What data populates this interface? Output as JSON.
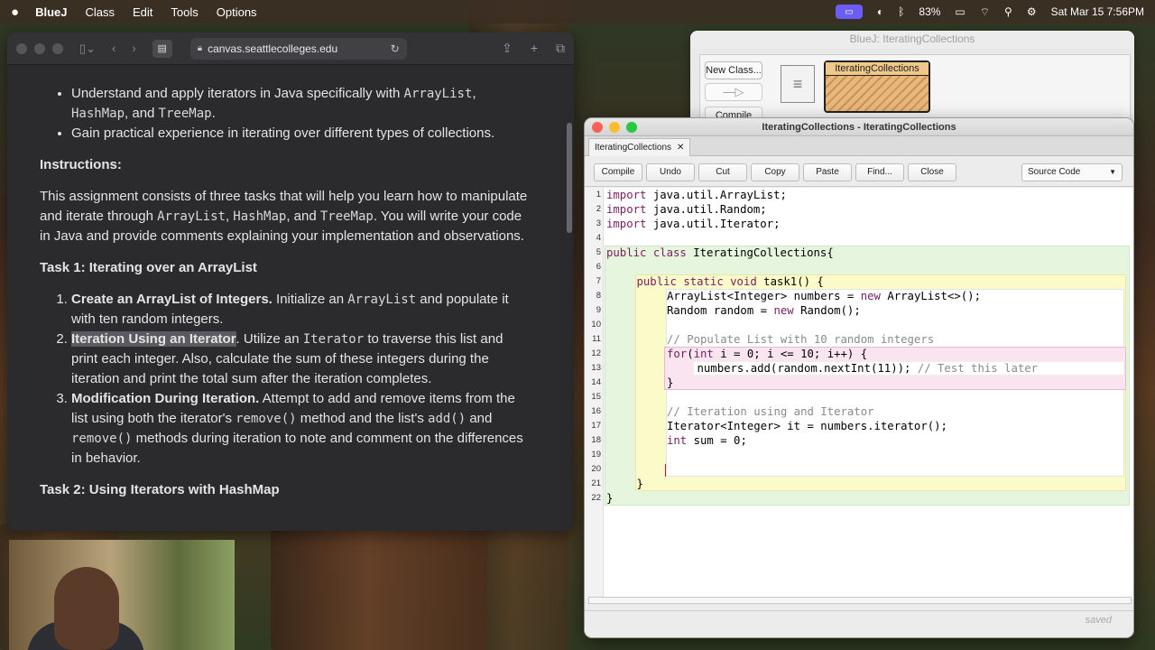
{
  "menubar": {
    "app": "BlueJ",
    "items": [
      "Class",
      "Edit",
      "Tools",
      "Options"
    ],
    "battery": "83%",
    "datetime": "Sat Mar 15  7:56PM"
  },
  "browser": {
    "url": "canvas.seattlecolleges.edu",
    "objectives": [
      {
        "pre": "Understand and apply iterators in Java specifically with ",
        "c1": "ArrayList",
        "mid": ",\n",
        "c2": "HashMap",
        "mid2": ", and ",
        "c3": "TreeMap",
        "post": "."
      },
      {
        "text": "Gain practical experience in iterating over different types of collections."
      }
    ],
    "instructions_heading": "Instructions:",
    "instructions_p1": "This assignment consists of three tasks that will help you learn how to manipulate and iterate through ",
    "instr_c1": "ArrayList",
    "instr_sep1": ", ",
    "instr_c2": "HashMap",
    "instr_sep2": ", and ",
    "instr_c3": "TreeMap",
    "instructions_p2": ". You will write your code in Java and provide comments explaining your implementation and observations.",
    "task1_heading": "Task 1: Iterating over an ArrayList",
    "steps": [
      {
        "bold": "Create an ArrayList of Integers.",
        "a": " Initialize an ",
        "c": "ArrayList",
        "b": " and populate it with ten random integers."
      },
      {
        "bold": "Iteration Using an Iterator",
        "a": ". Utilize an ",
        "c": "Iterator",
        "b": " to traverse this list and print each integer. Also, calculate the sum of these integers during the iteration and print the total sum after the iteration completes."
      },
      {
        "bold": "Modification During Iteration.",
        "a": " Attempt to add and remove items from the list using both the iterator's ",
        "c": "remove()",
        "b": " method and the list's ",
        "c2": "add()",
        "b2": " and ",
        "c3": "remove()",
        "b3": " methods during iteration to note and comment on the differences in behavior."
      }
    ],
    "task2_heading": "Task 2: Using Iterators with HashMap"
  },
  "bluej_main": {
    "title": "BlueJ:  IteratingCollections",
    "new_class": "New Class...",
    "arrow": "—▷",
    "compile": "Compile",
    "class_name": "IteratingCollections"
  },
  "editor": {
    "title": "IteratingCollections - IteratingCollections",
    "tab": "IteratingCollections",
    "tab_close": "✕",
    "buttons": [
      "Compile",
      "Undo",
      "Cut",
      "Copy",
      "Paste",
      "Find...",
      "Close"
    ],
    "view_select": "Source Code",
    "status": "saved",
    "lines": [
      [
        [
          "kw",
          "import"
        ],
        [
          "",
          "java.util.ArrayList;"
        ]
      ],
      [
        [
          "kw",
          "import"
        ],
        [
          "",
          "java.util.Random;"
        ]
      ],
      [
        [
          "kw",
          "import"
        ],
        [
          "",
          "java.util.Iterator;"
        ]
      ],
      [],
      [
        [
          "kw",
          "public class"
        ],
        [
          "",
          "IteratingCollections{"
        ]
      ],
      [],
      [
        [
          "kw",
          "public static void"
        ],
        [
          "",
          "task1() {"
        ]
      ],
      [
        [
          "",
          "ArrayList<Integer> numbers = "
        ],
        [
          "kw",
          "new"
        ],
        [
          "",
          " ArrayList<>();"
        ]
      ],
      [
        [
          "",
          "Random random = "
        ],
        [
          "kw",
          "new"
        ],
        [
          "",
          " Random();"
        ]
      ],
      [],
      [
        [
          "cm",
          "// Populate List with 10 random integers"
        ]
      ],
      [
        [
          "kw",
          "for"
        ],
        [
          "",
          "("
        ],
        [
          "kw",
          "int"
        ],
        [
          "",
          " i = 0; i <= 10; i++) {"
        ]
      ],
      [
        [
          "",
          "numbers.add(random.nextInt(11)); "
        ],
        [
          "cm",
          "// Test this later"
        ]
      ],
      [
        [
          "",
          "}"
        ]
      ],
      [],
      [
        [
          "cm",
          "// Iteration using and Iterator"
        ]
      ],
      [
        [
          "",
          "Iterator<Integer> it = numbers.iterator();"
        ]
      ],
      [
        [
          "kw",
          "int"
        ],
        [
          "",
          " sum = 0;"
        ]
      ],
      [],
      [],
      [
        [
          "",
          "}"
        ]
      ],
      [
        [
          "",
          "}"
        ]
      ]
    ]
  },
  "colors": {
    "accent": "#6b5cf5",
    "keyword": "#7a1d60",
    "comment": "#8a8a8a"
  }
}
